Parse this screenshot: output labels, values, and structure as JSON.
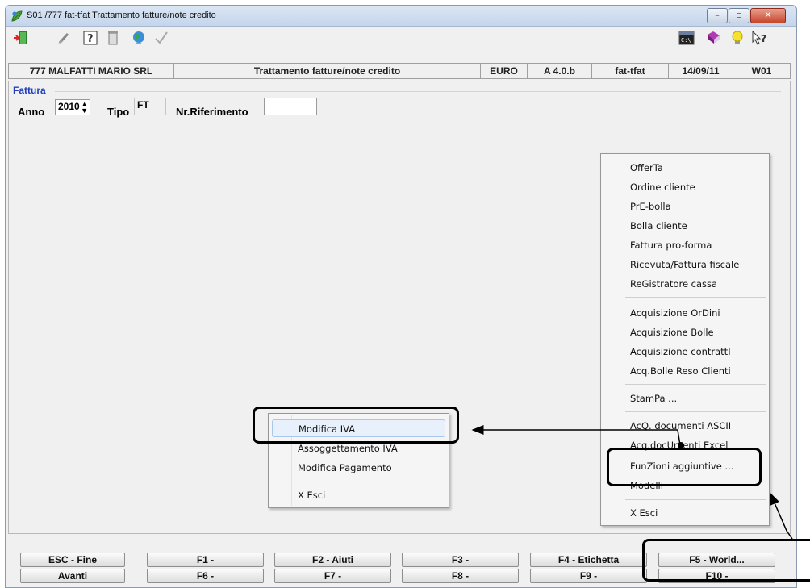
{
  "window": {
    "title": "S01 /777 fat-tfat Trattamento fatture/note credito"
  },
  "infobar": {
    "company": "777 MALFATTI MARIO SRL",
    "program": "Trattamento fatture/note credito",
    "currency": "EURO",
    "version": "A 4.0.b",
    "code": "fat-tfat",
    "date": "14/09/11",
    "workstation": "W01"
  },
  "form": {
    "group_label": "Fattura",
    "anno_label": "Anno",
    "anno_value": "2010",
    "tipo_label": "Tipo",
    "tipo_value": "FT",
    "nr_label": "Nr.Riferimento",
    "nr_value": ""
  },
  "context_menu_main": {
    "items": [
      "OfferTa",
      "Ordine cliente",
      "PrE-bolla",
      "Bolla cliente",
      "Fattura pro-forma",
      "Ricevuta/Fattura fiscale",
      "ReGistratore cassa",
      "Acquisizione OrDini",
      "Acquisizione Bolle",
      "Acquisizione contrattI",
      "Acq.Bolle Reso Clienti",
      "StamPa ...",
      "AcQ. documenti ASCII",
      "Acq.docUmenti Excel",
      "FunZioni aggiuntive ...",
      "Modelli",
      "X Esci"
    ]
  },
  "context_menu_sub": {
    "items": [
      "Modifica IVA",
      "Assoggettamento IVA",
      "Modifica Pagamento",
      "X Esci"
    ]
  },
  "function_keys": {
    "row1": [
      "ESC - Fine",
      "F1 -",
      "F2 - Aiuti",
      "F3 -",
      "F4 - Etichetta",
      "F5 - World..."
    ],
    "row2": [
      "Avanti",
      "F6 -",
      "F7 -",
      "F8 -",
      "F9 -",
      "F10 -"
    ]
  },
  "icons": {
    "app": "app-leaf-icon",
    "exit": "exit-door-icon",
    "clear": "broom-icon",
    "help": "question-box-icon",
    "trash": "trash-icon",
    "globe": "globe-icon",
    "confirm": "checkmark-icon",
    "console": "console-icon",
    "book": "book-icon",
    "tip": "lightbulb-icon",
    "whatsthis": "whats-this-icon"
  }
}
